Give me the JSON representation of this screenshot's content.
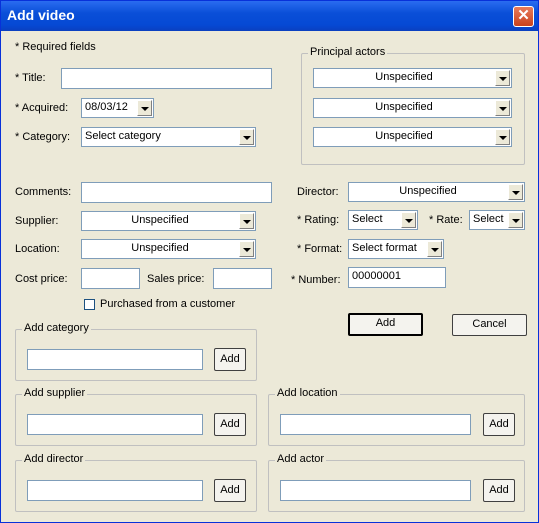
{
  "window": {
    "title": "Add video"
  },
  "required_note": "* Required fields",
  "labels": {
    "title": "* Title:",
    "acquired": "* Acquired:",
    "category": "* Category:",
    "comments": "Comments:",
    "supplier": "Supplier:",
    "location": "Location:",
    "cost_price": "Cost price:",
    "sales_price": "Sales price:",
    "director": "Director:",
    "rating": "* Rating:",
    "rate": "* Rate:",
    "format": "* Format:",
    "number": "* Number:"
  },
  "fields": {
    "title": "",
    "acquired": "08/03/12",
    "category": "Select category",
    "comments": "",
    "supplier": "Unspecified",
    "location": "Unspecified",
    "cost_price": "",
    "sales_price": "",
    "director": "Unspecified",
    "rating": "Select",
    "rate": "Select",
    "format": "Select format",
    "number": "00000001"
  },
  "principal_actors": {
    "legend": "Principal actors",
    "actors": [
      "Unspecified",
      "Unspecified",
      "Unspecified"
    ]
  },
  "purchased_checkbox": {
    "label": "Purchased from a customer",
    "checked": false
  },
  "buttons": {
    "add": "Add",
    "cancel": "Cancel"
  },
  "groups": {
    "add_category": {
      "legend": "Add category",
      "button": "Add"
    },
    "add_supplier": {
      "legend": "Add supplier",
      "button": "Add"
    },
    "add_location": {
      "legend": "Add location",
      "button": "Add"
    },
    "add_director": {
      "legend": "Add director",
      "button": "Add"
    },
    "add_actor": {
      "legend": "Add actor",
      "button": "Add"
    }
  },
  "colors": {
    "titlebar": "#0a4fd8",
    "dialog_bg": "#ece9d8",
    "field_border": "#7f9db9"
  }
}
